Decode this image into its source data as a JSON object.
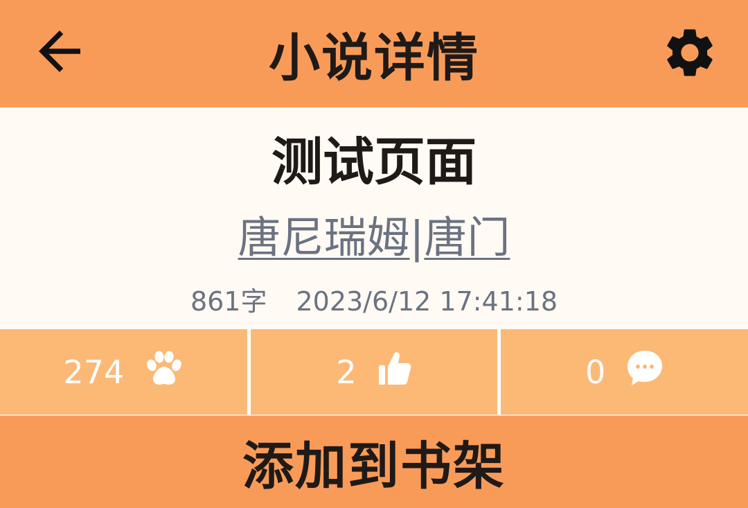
{
  "header": {
    "title": "小说详情",
    "back_icon": "arrow-left-icon",
    "settings_icon": "gear-icon"
  },
  "novel": {
    "title": "测试页面",
    "authors": [
      "唐尼瑞姆",
      "唐门"
    ],
    "author_separator": "|",
    "word_count": "861字",
    "updated": "2023/6/12 17:41:18"
  },
  "stats": {
    "views": "274",
    "views_icon": "paw-icon",
    "likes": "2",
    "likes_icon": "thumbs-up-icon",
    "comments": "0",
    "comments_icon": "chat-bubble-icon"
  },
  "actions": {
    "add_to_shelf": "添加到书架"
  },
  "colors": {
    "header_bg": "#f99b58",
    "stats_bg": "#fcb976",
    "content_bg": "#fffaf4",
    "text_dark": "#1f1a17",
    "text_muted": "#6b7280"
  }
}
